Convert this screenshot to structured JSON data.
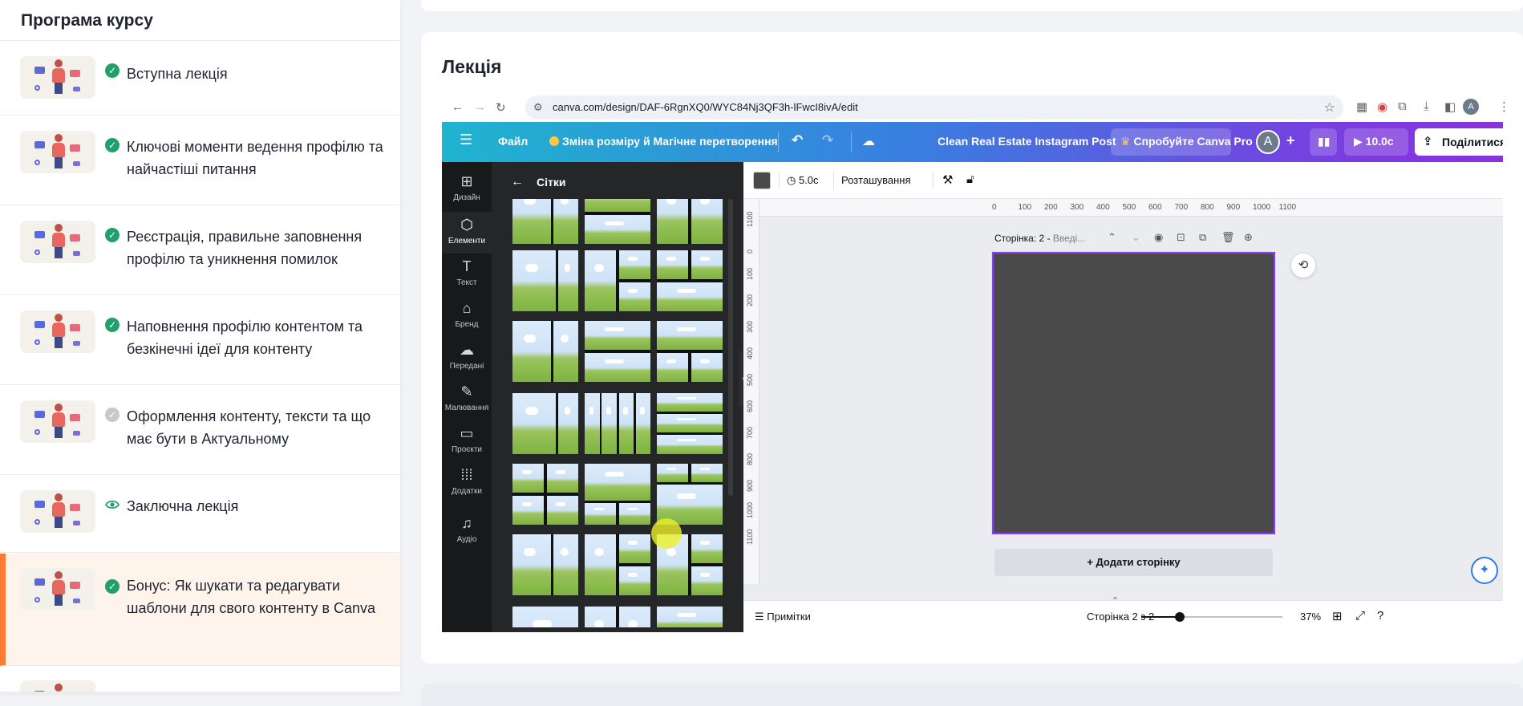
{
  "sidebar": {
    "title": "Програма курсу",
    "lessons": [
      {
        "label": "Вступна лекція",
        "status": "done"
      },
      {
        "label": "Ключові моменти ведення профілю та найчастіші питання",
        "status": "done"
      },
      {
        "label": "Реєстрація, правильне заповнення профілю та уникнення помилок",
        "status": "done"
      },
      {
        "label": "Наповнення профілю контентом та безкінечні ідеї для контенту",
        "status": "done"
      },
      {
        "label": "Оформлення контенту, тексти та що має бути в Актуальному",
        "status": "pending"
      },
      {
        "label": "Заключна лекція",
        "status": "viewing"
      },
      {
        "label": "Бонус: Як шукати та редагувати шаблони для свого контенту в Canva",
        "status": "done",
        "active": true
      }
    ]
  },
  "main": {
    "title": "Лекція"
  },
  "browser": {
    "url": "canva.com/design/DAF-6RgnXQ0/WYC84Nj3QF3h-lFwcI8ivA/edit",
    "profile_initial": "A"
  },
  "canva": {
    "menu": {
      "file": "Файл",
      "resize": "Зміна розміру й Магічне перетворення",
      "design_name": "Clean Real Estate Instagram Post",
      "try_pro": "Спробуйте Canva Pro",
      "avatar": "A",
      "play_time": "10.0с",
      "share": "Поділитися"
    },
    "rail": [
      {
        "label": "Дизайн",
        "icon": "design-icon"
      },
      {
        "label": "Елементи",
        "icon": "elements-icon",
        "active": true
      },
      {
        "label": "Текст",
        "icon": "text-icon"
      },
      {
        "label": "Бренд",
        "icon": "brand-icon"
      },
      {
        "label": "Передані",
        "icon": "upload-icon"
      },
      {
        "label": "Малювання",
        "icon": "draw-icon"
      },
      {
        "label": "Проєкти",
        "icon": "folder-icon"
      },
      {
        "label": "Додатки",
        "icon": "apps-icon"
      },
      {
        "label": "Аудіо",
        "icon": "audio-icon"
      }
    ],
    "panel": {
      "title": "Сітки"
    },
    "toolbar": {
      "duration": "5.0с",
      "position": "Розташування"
    },
    "ruler_top": [
      "0",
      "100",
      "200",
      "300",
      "400",
      "500",
      "600",
      "700",
      "800",
      "900",
      "1000",
      "1100"
    ],
    "ruler_left": [
      "1100",
      "0",
      "100",
      "200",
      "300",
      "400",
      "500",
      "600",
      "700",
      "800",
      "900",
      "1000",
      "1100"
    ],
    "page_header": {
      "label": "Сторінка: 2 - ",
      "placeholder": "Введі..."
    },
    "add_page": "+ Додати сторінку",
    "footer": {
      "notes": "Примітки",
      "page_count": "Сторінка 2 з 2",
      "zoom": "37%",
      "zoom_level": 0.37
    }
  }
}
